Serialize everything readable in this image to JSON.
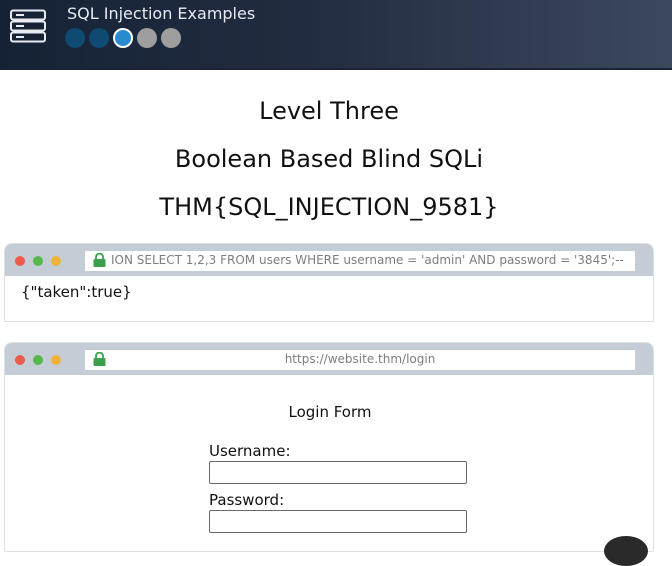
{
  "app": {
    "title": "SQL Injection Examples",
    "logo_icon": "server-stack-icon",
    "progress": {
      "total": 5,
      "current": 3,
      "completed": 2
    }
  },
  "headings": {
    "level": "Level Three",
    "technique": "Boolean Based Blind SQLi",
    "flag": "THM{SQL_INJECTION_9581}"
  },
  "query_browser": {
    "url": "ION SELECT 1,2,3 FROM users WHERE username = 'admin' AND password = '3845';--",
    "response": "{\"taken\":true}"
  },
  "login_browser": {
    "url": "https://website.thm/login",
    "form_title": "Login Form",
    "username_label": "Username:",
    "username_value": "",
    "password_label": "Password:",
    "password_value": ""
  },
  "colors": {
    "header_bg": "#222c40",
    "step_done": "#0e4a72",
    "step_current": "#2a8ad0",
    "step_todo": "#9e9e9e",
    "browser_bar": "#c4ccd6",
    "lock": "#3aa04a"
  }
}
